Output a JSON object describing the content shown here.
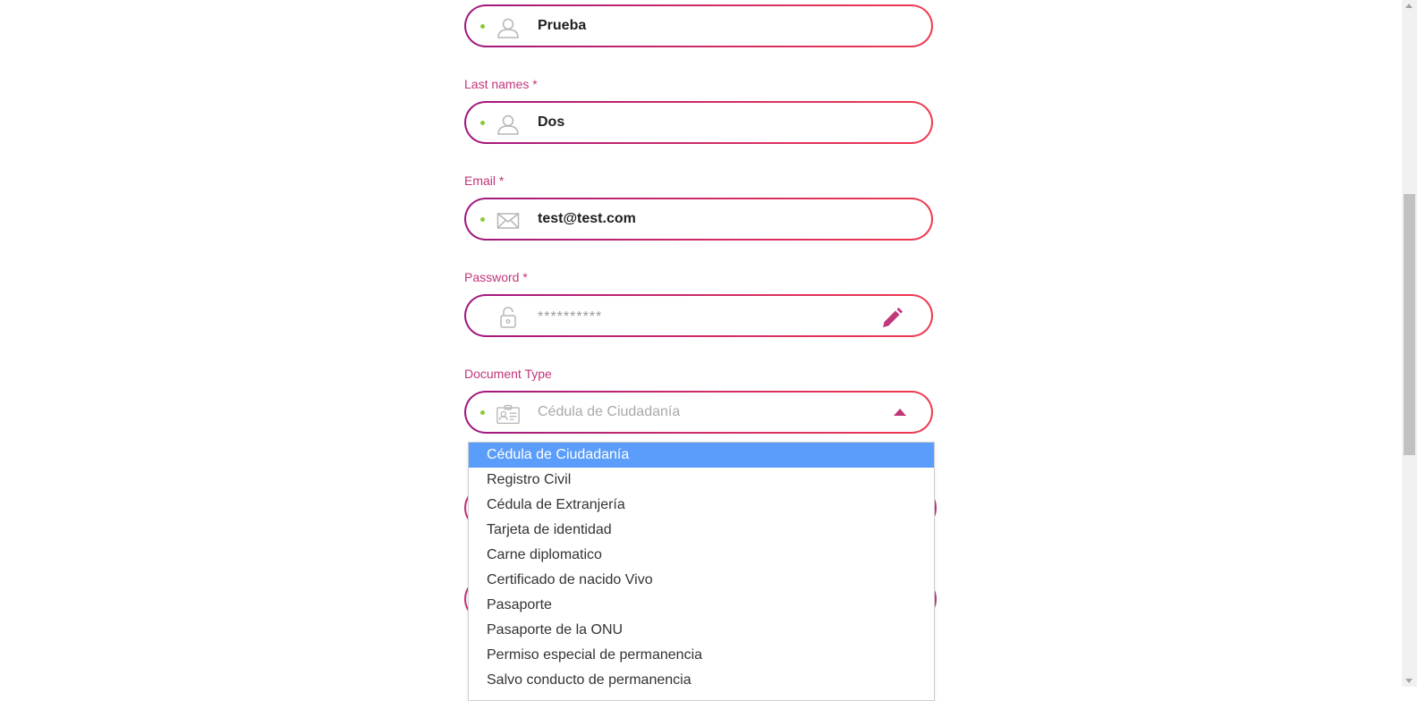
{
  "form": {
    "first_name": {
      "value": "Prueba",
      "icon": "user-icon"
    },
    "last_names": {
      "label": "Last names *",
      "value": "Dos",
      "icon": "user-icon"
    },
    "email": {
      "label": "Email *",
      "value": "test@test.com",
      "icon": "envelope-icon"
    },
    "password": {
      "label": "Password *",
      "value": "**********",
      "icon": "lock-icon",
      "action_icon": "pencil-icon"
    },
    "document_type": {
      "label": "Document Type",
      "placeholder": "Cédula de Ciudadanía",
      "icon": "id-card-icon",
      "options": [
        {
          "label": "Cédula de Ciudadanía",
          "selected": true
        },
        {
          "label": "Registro Civil"
        },
        {
          "label": "Cédula de Extranjería"
        },
        {
          "label": "Tarjeta de identidad"
        },
        {
          "label": "Carne diplomatico"
        },
        {
          "label": "Certificado de nacido Vivo"
        },
        {
          "label": "Pasaporte"
        },
        {
          "label": "Pasaporte de la ONU"
        },
        {
          "label": "Permiso especial de permanencia"
        },
        {
          "label": "Salvo conducto de permanencia"
        }
      ]
    }
  },
  "colors": {
    "label": "#c2367a",
    "border_start": "#a0177f",
    "border_end": "#ef3a4f",
    "dot": "#8cc63f",
    "selected_option": "#5b9dfa"
  }
}
